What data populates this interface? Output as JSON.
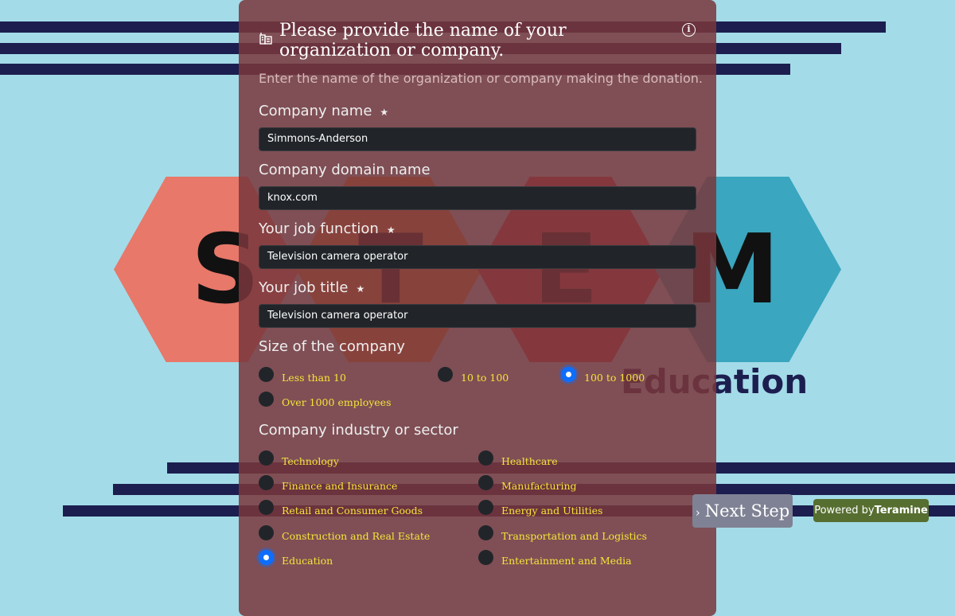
{
  "background": {
    "letters": [
      "S",
      "T",
      "E",
      "M"
    ],
    "tagline": "Education",
    "hex_colors": [
      "#e8786a",
      "#e0853e",
      "#c8404c",
      "#3aa6bf"
    ]
  },
  "form": {
    "title": "Please provide the name of your organization or company.",
    "subtitle": "Enter the name of the organization or company making the donation.",
    "required_mark": "★",
    "fields": [
      {
        "label": "Company name",
        "required": true,
        "value": "Simmons-Anderson"
      },
      {
        "label": "Company domain name",
        "required": false,
        "value": "knox.com"
      },
      {
        "label": "Your job function",
        "required": true,
        "value": "Television camera operator"
      },
      {
        "label": "Your job title",
        "required": true,
        "value": "Television camera operator"
      }
    ],
    "size": {
      "label": "Size of the company",
      "options": [
        "Less than 10",
        "10 to 100",
        "100 to 1000",
        "Over 1000 employees"
      ],
      "selected": "100 to 1000"
    },
    "industry": {
      "label": "Company industry or sector",
      "options": [
        "Technology",
        "Healthcare",
        "Finance and Insurance",
        "Manufacturing",
        "Retail and Consumer Goods",
        "Energy and Utilities",
        "Construction and Real Estate",
        "Transportation and Logistics",
        "Education",
        "Entertainment and Media"
      ],
      "selected": "Education"
    }
  },
  "next_button": {
    "icon": "chevron-right-icon",
    "label": "Next Step"
  },
  "powered": {
    "prefix": "Powered by",
    "brand": "Teramine"
  },
  "colors": {
    "panel": "#7f4f55",
    "accent": "#0d6efd",
    "option_text": "#f5e43a",
    "powered_bg": "#566e30"
  }
}
